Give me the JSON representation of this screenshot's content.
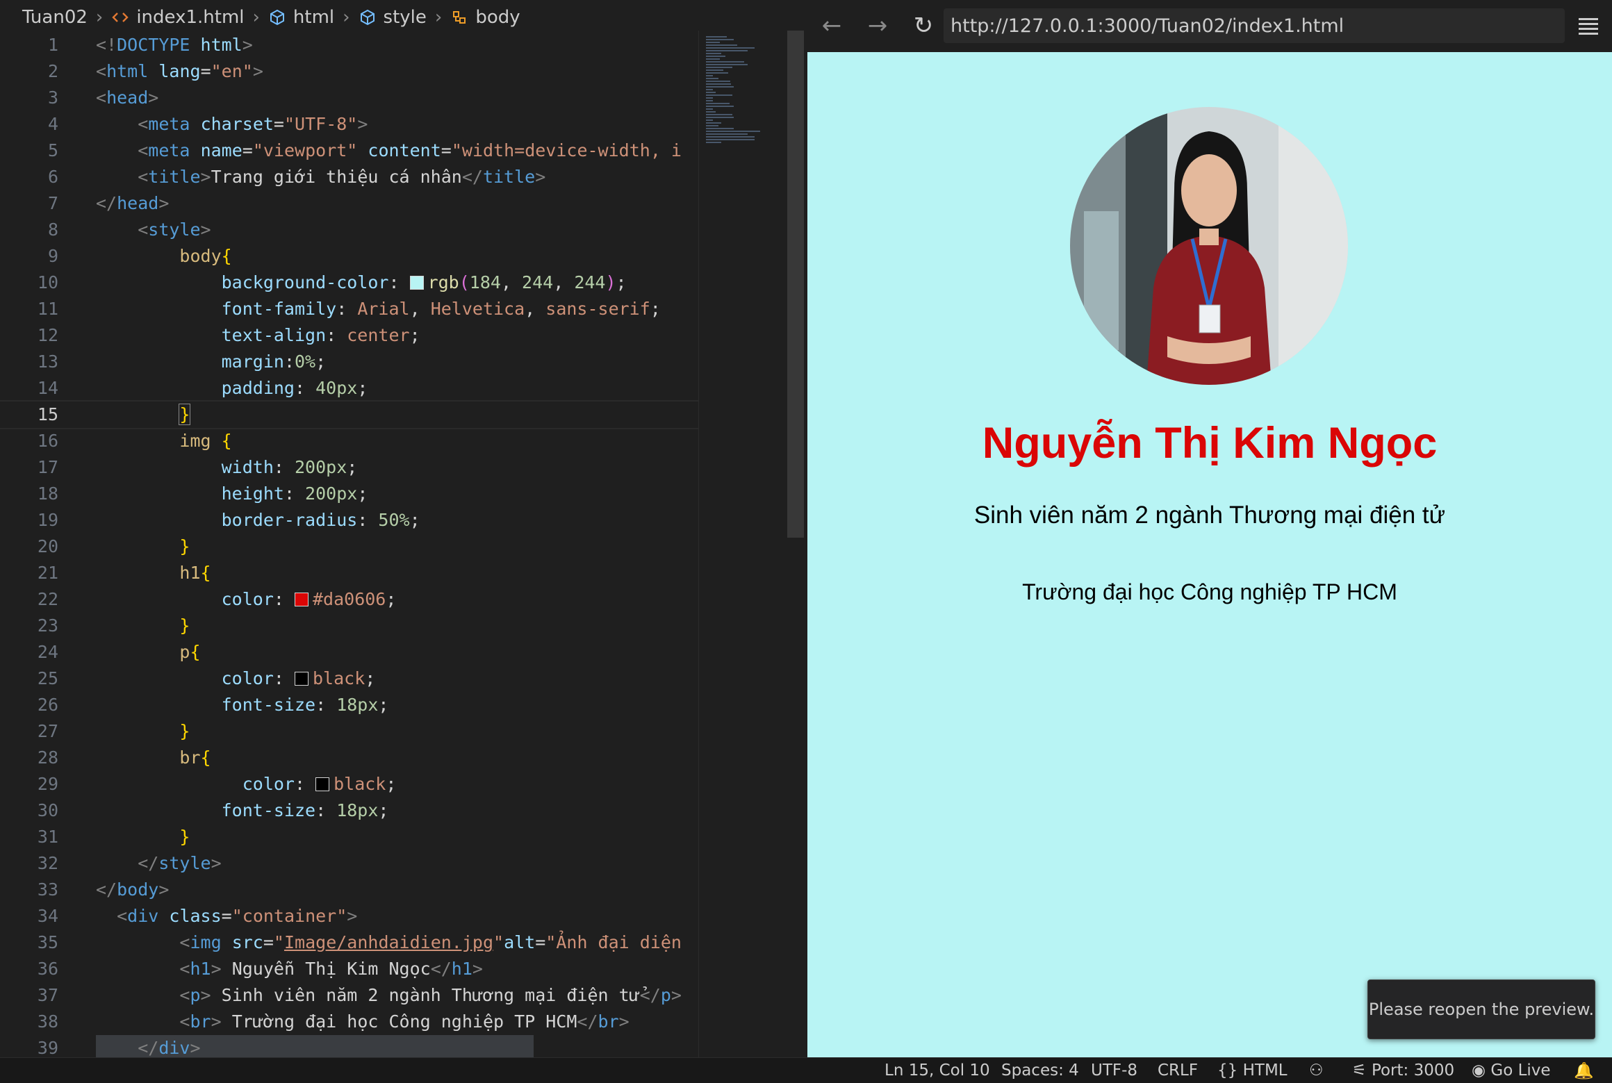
{
  "breadcrumb": [
    "Tuan02",
    "index1.html",
    "html",
    "style",
    "body"
  ],
  "editor": {
    "current_line": 15,
    "lines": [
      {
        "n": "1",
        "html": "<span class='t-br'>&lt;!</span><span class='t-tag'>DOCTYPE</span> <span class='t-attr'>html</span><span class='t-br'>&gt;</span>"
      },
      {
        "n": "2",
        "html": "<span class='t-br'>&lt;</span><span class='t-tag'>html</span> <span class='t-attr'>lang</span><span class='t-pun'>=</span><span class='t-str'>\"en\"</span><span class='t-br'>&gt;</span>"
      },
      {
        "n": "3",
        "html": "<span class='t-br'>&lt;</span><span class='t-tag'>head</span><span class='t-br'>&gt;</span>"
      },
      {
        "n": "4",
        "html": "    <span class='t-br'>&lt;</span><span class='t-tag'>meta</span> <span class='t-attr'>charset</span><span class='t-pun'>=</span><span class='t-str'>\"UTF-8\"</span><span class='t-br'>&gt;</span>"
      },
      {
        "n": "5",
        "html": "    <span class='t-br'>&lt;</span><span class='t-tag'>meta</span> <span class='t-attr'>name</span><span class='t-pun'>=</span><span class='t-str'>\"viewport\"</span> <span class='t-attr'>content</span><span class='t-pun'>=</span><span class='t-str'>\"width=device-width, i</span>"
      },
      {
        "n": "6",
        "html": "    <span class='t-br'>&lt;</span><span class='t-tag'>title</span><span class='t-br'>&gt;</span><span class='t-text'>Trang giới thiệu cá nhân</span><span class='t-br'>&lt;/</span><span class='t-tag'>title</span><span class='t-br'>&gt;</span>"
      },
      {
        "n": "7",
        "html": "<span class='t-br'>&lt;/</span><span class='t-tag'>head</span><span class='t-br'>&gt;</span>"
      },
      {
        "n": "8",
        "html": "    <span class='t-br'>&lt;</span><span class='t-tag'>style</span><span class='t-br'>&gt;</span>"
      },
      {
        "n": "9",
        "html": "        <span class='t-sel'>body</span><span class='t-b1'>{</span>"
      },
      {
        "n": "10",
        "html": "            <span class='t-prop'>background-color</span><span class='t-pun'>: </span><span class='swatch' style='background:rgb(184,244,244)'></span><span class='t-fn'>rgb</span><span class='t-b2'>(</span><span class='t-num'>184</span><span class='t-pun'>, </span><span class='t-num'>244</span><span class='t-pun'>, </span><span class='t-num'>244</span><span class='t-b2'>)</span><span class='t-pun'>;</span>"
      },
      {
        "n": "11",
        "html": "            <span class='t-prop'>font-family</span><span class='t-pun'>: </span><span class='t-val'>Arial</span><span class='t-pun'>, </span><span class='t-val'>Helvetica</span><span class='t-pun'>, </span><span class='t-val'>sans-serif</span><span class='t-pun'>;</span>"
      },
      {
        "n": "12",
        "html": "            <span class='t-prop'>text-align</span><span class='t-pun'>: </span><span class='t-val'>center</span><span class='t-pun'>;</span>"
      },
      {
        "n": "13",
        "html": "            <span class='t-prop'>margin</span><span class='t-pun'>:</span><span class='t-num'>0%</span><span class='t-pun'>;</span>"
      },
      {
        "n": "14",
        "html": "            <span class='t-prop'>padding</span><span class='t-pun'>: </span><span class='t-num'>40px</span><span class='t-pun'>;</span>"
      },
      {
        "n": "15",
        "html": "        <span class='t-b1' style='outline:1px solid #888'>}</span>"
      },
      {
        "n": "16",
        "html": "        <span class='t-sel'>img</span> <span class='t-b1'>{</span>"
      },
      {
        "n": "17",
        "html": "            <span class='t-prop'>width</span><span class='t-pun'>: </span><span class='t-num'>200px</span><span class='t-pun'>;</span>"
      },
      {
        "n": "18",
        "html": "            <span class='t-prop'>height</span><span class='t-pun'>: </span><span class='t-num'>200px</span><span class='t-pun'>;</span>"
      },
      {
        "n": "19",
        "html": "            <span class='t-prop'>border-radius</span><span class='t-pun'>: </span><span class='t-num'>50%</span><span class='t-pun'>;</span>"
      },
      {
        "n": "20",
        "html": "        <span class='t-b1'>}</span>"
      },
      {
        "n": "21",
        "html": "        <span class='t-sel'>h1</span><span class='t-b1'>{</span>"
      },
      {
        "n": "22",
        "html": "            <span class='t-prop'>color</span><span class='t-pun'>: </span><span class='swatch' style='background:#da0606'></span><span class='t-val'>#da0606</span><span class='t-pun'>;</span>"
      },
      {
        "n": "23",
        "html": "        <span class='t-b1'>}</span>"
      },
      {
        "n": "24",
        "html": "        <span class='t-sel'>p</span><span class='t-b1'>{</span>"
      },
      {
        "n": "25",
        "html": "            <span class='t-prop'>color</span><span class='t-pun'>: </span><span class='swatch' style='background:#000'></span><span class='t-val'>black</span><span class='t-pun'>;</span>"
      },
      {
        "n": "26",
        "html": "            <span class='t-prop'>font-size</span><span class='t-pun'>: </span><span class='t-num'>18px</span><span class='t-pun'>;</span>"
      },
      {
        "n": "27",
        "html": "        <span class='t-b1'>}</span>"
      },
      {
        "n": "28",
        "html": "        <span class='t-sel'>br</span><span class='t-b1'>{</span>"
      },
      {
        "n": "29",
        "html": "              <span class='t-prop'>color</span><span class='t-pun'>: </span><span class='swatch' style='background:#000'></span><span class='t-val'>black</span><span class='t-pun'>;</span>"
      },
      {
        "n": "30",
        "html": "            <span class='t-prop'>font-size</span><span class='t-pun'>: </span><span class='t-num'>18px</span><span class='t-pun'>;</span>"
      },
      {
        "n": "31",
        "html": "        <span class='t-b1'>}</span>"
      },
      {
        "n": "32",
        "html": "    <span class='t-br'>&lt;/</span><span class='t-tag'>style</span><span class='t-br'>&gt;</span>"
      },
      {
        "n": "33",
        "html": "<span class='t-br'>&lt;/</span><span class='t-tag'>body</span><span class='t-br'>&gt;</span>"
      },
      {
        "n": "34",
        "html": "  <span class='t-br'>&lt;</span><span class='t-tag'>div</span> <span class='t-attr'>class</span><span class='t-pun'>=</span><span class='t-str'>\"container\"</span><span class='t-br'>&gt;</span>"
      },
      {
        "n": "35",
        "html": "        <span class='t-br'>&lt;</span><span class='t-tag'>img</span> <span class='t-attr'>src</span><span class='t-pun'>=</span><span class='t-str'>\"<span class='t-u'>Image/anhdaidien.jpg</span>\"</span><span class='t-attr'>alt</span><span class='t-pun'>=</span><span class='t-str'>\"Ảnh đại diện</span>"
      },
      {
        "n": "36",
        "html": "        <span class='t-br'>&lt;</span><span class='t-tag'>h1</span><span class='t-br'>&gt;</span><span class='t-text'> Nguyễn Thị Kim Ngọc</span><span class='t-br'>&lt;/</span><span class='t-tag'>h1</span><span class='t-br'>&gt;</span>"
      },
      {
        "n": "37",
        "html": "        <span class='t-br'>&lt;</span><span class='t-tag'>p</span><span class='t-br'>&gt;</span><span class='t-text'> Sinh viên năm 2 ngành Thương mại điện tử</span><span class='t-br'>&lt;/</span><span class='t-tag'>p</span><span class='t-br'>&gt;</span>"
      },
      {
        "n": "38",
        "html": "        <span class='t-br'>&lt;</span><span class='t-tag'>br</span><span class='t-br'>&gt;</span><span class='t-text'> Trường đại học Công nghiệp TP HCM</span><span class='t-br'>&lt;/</span><span class='t-tag'>br</span><span class='t-br'>&gt;</span>"
      },
      {
        "n": "39",
        "html": "    <span class='t-br'>&lt;/</span><span class='t-tag'>div</span><span class='t-br'>&gt;</span>"
      }
    ]
  },
  "browser": {
    "url": "http://127.0.0.1:3000/Tuan02/index1.html",
    "back_icon": "←",
    "forward_icon": "→",
    "reload_icon": "↻",
    "page": {
      "name": "Nguyễn Thị Kim Ngọc",
      "subtitle": "Sinh viên năm 2 ngành Thương mại điện tử",
      "school": "Trường đại học Công nghiệp TP HCM",
      "background": "#b8f4f4",
      "name_color": "#da0606"
    },
    "toast": "Please reopen the preview."
  },
  "statusbar": {
    "position": "Ln 15, Col 10",
    "spaces": "Spaces: 4",
    "encoding": "UTF-8",
    "eol": "CRLF",
    "language": "HTML",
    "port": "Port: 3000",
    "golive": "Go Live"
  }
}
